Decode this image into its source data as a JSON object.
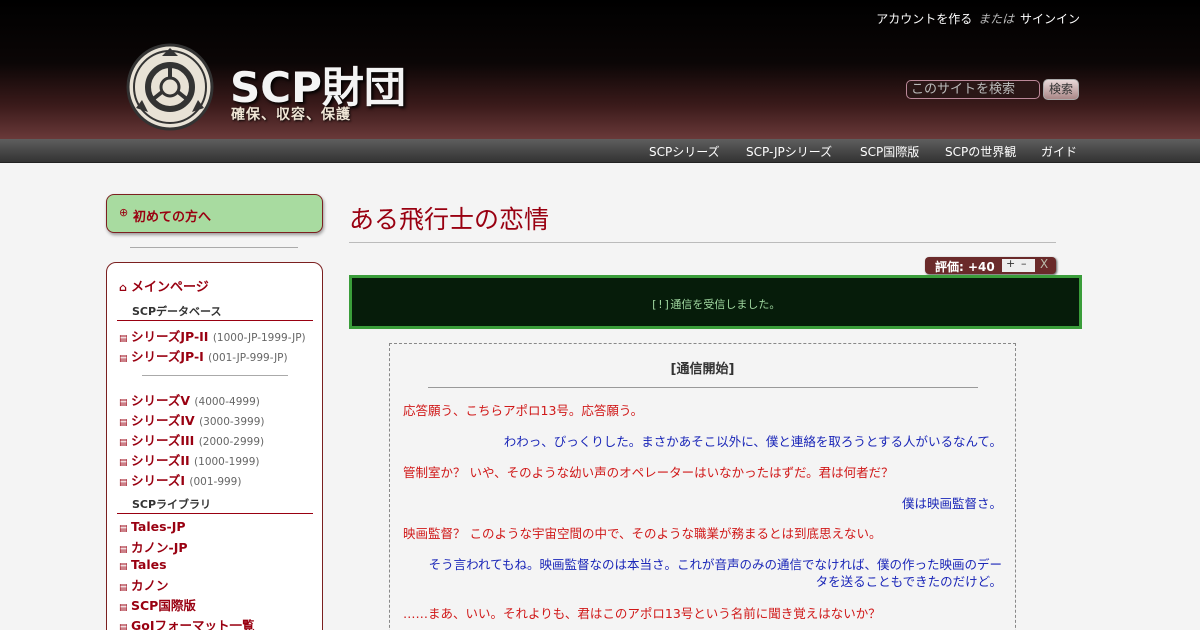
{
  "header": {
    "account_link": "アカウントを作る",
    "or_text": "または",
    "signin_link": "サインイン",
    "site_title": "SCP財団",
    "site_subtitle": "確保、収容、保護",
    "search_placeholder": "このサイトを検索",
    "search_button": "検索"
  },
  "topnav": {
    "items": [
      "SCPシリーズ",
      "SCP-JPシリーズ",
      "SCP国際版",
      "SCPの世界観",
      "ガイド"
    ]
  },
  "sidebar": {
    "welcome": "初めての方へ",
    "main_page": "メインページ",
    "section_db": "SCPデータベース",
    "jp_series": [
      {
        "label": "シリーズJP-II",
        "range": "(1000-JP-1999-JP)"
      },
      {
        "label": "シリーズJP-I",
        "range": "(001-JP-999-JP)"
      }
    ],
    "series": [
      {
        "label": "シリーズV",
        "range": "(4000-4999)"
      },
      {
        "label": "シリーズIV",
        "range": "(3000-3999)"
      },
      {
        "label": "シリーズIII",
        "range": "(2000-2999)"
      },
      {
        "label": "シリーズII",
        "range": "(1000-1999)"
      },
      {
        "label": "シリーズI",
        "range": "(001-999)"
      }
    ],
    "section_library": "SCPライブラリ",
    "library": [
      "Tales-JP",
      "カノン-JP",
      "Tales",
      "カノン",
      "SCP国際版",
      "GoIフォーマット一覧"
    ]
  },
  "main": {
    "title": "ある飛行士の恋情",
    "rating_label": "評価: +40",
    "rating_plus": "+",
    "rating_minus": "–",
    "rating_close": "X",
    "terminal_message": "[!]通信を受信しました。",
    "log_header": "[通信開始]",
    "log_lines": [
      {
        "speaker": "red",
        "text": "応答願う、こちらアポロ13号。応答願う。"
      },
      {
        "speaker": "blue",
        "text": "わわっ、びっくりした。まさかあそこ以外に、僕と連絡を取ろうとする人がいるなんて。"
      },
      {
        "speaker": "red",
        "text": "管制室か？ いや、そのような幼い声のオペレーターはいなかったはずだ。君は何者だ？"
      },
      {
        "speaker": "blue",
        "text": "僕は映画監督さ。"
      },
      {
        "speaker": "red",
        "text": "映画監督？ このような宇宙空間の中で、そのような職業が務まるとは到底思えない。"
      },
      {
        "speaker": "blue",
        "text": "そう言われてもね。映画監督なのは本当さ。これが音声のみの通信でなければ、僕の作った映画のデー"
      },
      {
        "speaker": "blue",
        "text": "タを送ることもできたのだけど。"
      },
      {
        "speaker": "red",
        "text": "……まあ、いい。それよりも、君はこのアポロ13号という名前に聞き覚えはないか？"
      }
    ]
  },
  "colors": {
    "accent": "#990011",
    "welcome_bg": "#a8dba0",
    "terminal_bg": "#061c0a",
    "terminal_border": "#3a9d3a",
    "speaker_red": "#d01818",
    "speaker_blue": "#1a26b8"
  }
}
